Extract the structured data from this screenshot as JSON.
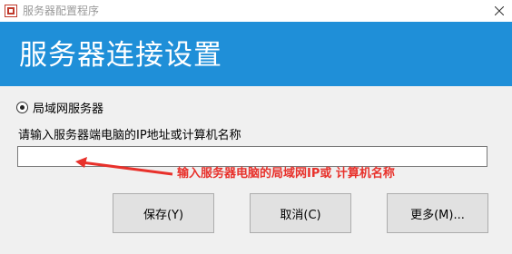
{
  "window": {
    "title": "服务器配置程序",
    "close_icon": "close-icon",
    "app_icon": "server-app-icon"
  },
  "header": {
    "title": "服务器连接设置",
    "background": "#1f8fd8"
  },
  "server_type": {
    "label": "局域网服务器",
    "selected": true
  },
  "host_field": {
    "label": "请输入服务器端电脑的IP地址或计算机名称",
    "value": ""
  },
  "annotation": {
    "text": "输入服务器电脑的局域网IP或 计算机名称",
    "color": "#e8312b"
  },
  "buttons": {
    "save": "保存(Y)",
    "cancel": "取消(C)",
    "more": "更多(M)..."
  }
}
